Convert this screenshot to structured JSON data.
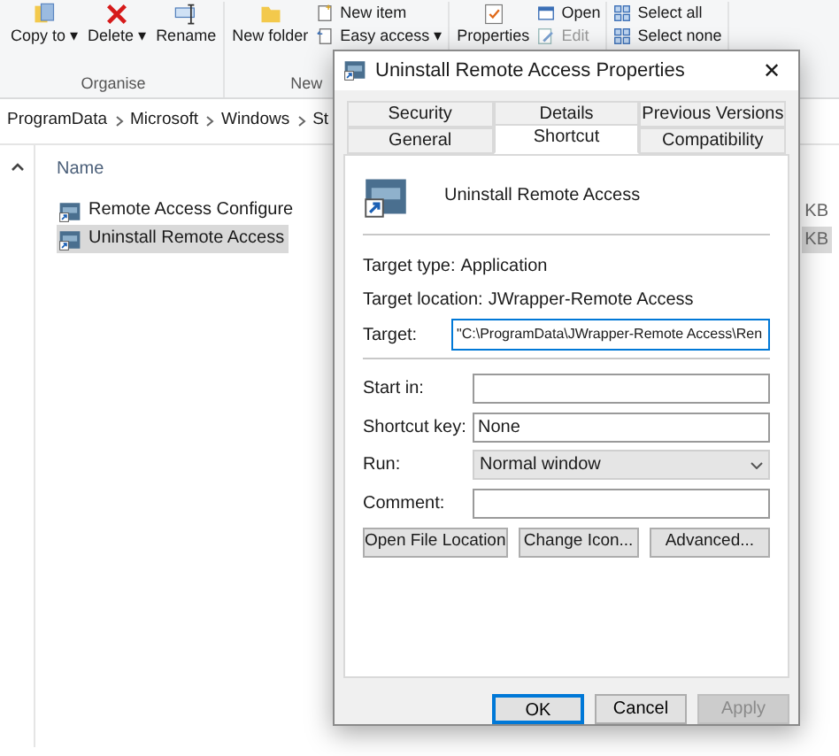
{
  "ribbon": {
    "groups": [
      {
        "label": "Organise",
        "items": [
          {
            "kind": "large",
            "label": "Copy to ▾"
          },
          {
            "kind": "large",
            "label": "Delete ▾"
          },
          {
            "kind": "large",
            "label": "Rename"
          }
        ]
      },
      {
        "label": "New",
        "items": [
          {
            "kind": "large",
            "label": "New folder"
          },
          {
            "kind": "small",
            "label": "New item"
          },
          {
            "kind": "small",
            "label": "Easy access ▾"
          }
        ]
      },
      {
        "items": [
          {
            "kind": "large",
            "label": "Properties"
          },
          {
            "kind": "small",
            "label": "Open",
            "disabled": false
          },
          {
            "kind": "small",
            "label": "Edit",
            "disabled": true
          }
        ]
      },
      {
        "items": [
          {
            "kind": "small",
            "label": "Select all"
          },
          {
            "kind": "small",
            "label": "Select none"
          }
        ]
      }
    ]
  },
  "breadcrumb": [
    "ProgramData",
    "Microsoft",
    "Windows",
    "St"
  ],
  "file_list": {
    "column": "Name",
    "rows": [
      {
        "name": "Remote Access Configure",
        "size": "KB",
        "selected": false
      },
      {
        "name": "Uninstall Remote Access",
        "size": "KB",
        "selected": true
      }
    ]
  },
  "dialog": {
    "title": "Uninstall Remote Access Properties",
    "close": "✕",
    "tab_rows": [
      [
        {
          "label": "Security",
          "selected": false
        },
        {
          "label": "Details",
          "selected": false
        },
        {
          "label": "Previous Versions",
          "selected": false
        }
      ],
      [
        {
          "label": "General",
          "selected": false
        },
        {
          "label": "Shortcut",
          "selected": true
        },
        {
          "label": "Compatibility",
          "selected": false
        }
      ]
    ],
    "name": "Uninstall Remote Access",
    "info": [
      {
        "label": "Target type:",
        "value": "Application"
      },
      {
        "label": "Target location:",
        "value": "JWrapper-Remote Access"
      }
    ],
    "target": {
      "label": "Target:",
      "value": "\"C:\\ProgramData\\JWrapper-Remote Access\\Ren"
    },
    "fields": [
      {
        "kind": "text",
        "label": "Start in:"
      },
      {
        "kind": "text",
        "label": "Shortcut key:",
        "value": "None"
      },
      {
        "kind": "select",
        "label": "Run:",
        "value": "Normal window"
      },
      {
        "kind": "text",
        "label": "Comment:"
      }
    ],
    "actions": [
      "Open File Location",
      "Change Icon...",
      "Advanced..."
    ],
    "buttons": [
      {
        "label": "OK",
        "default": true,
        "disabled": false
      },
      {
        "label": "Cancel",
        "default": false,
        "disabled": false
      },
      {
        "label": "Apply",
        "default": false,
        "disabled": true
      }
    ]
  }
}
